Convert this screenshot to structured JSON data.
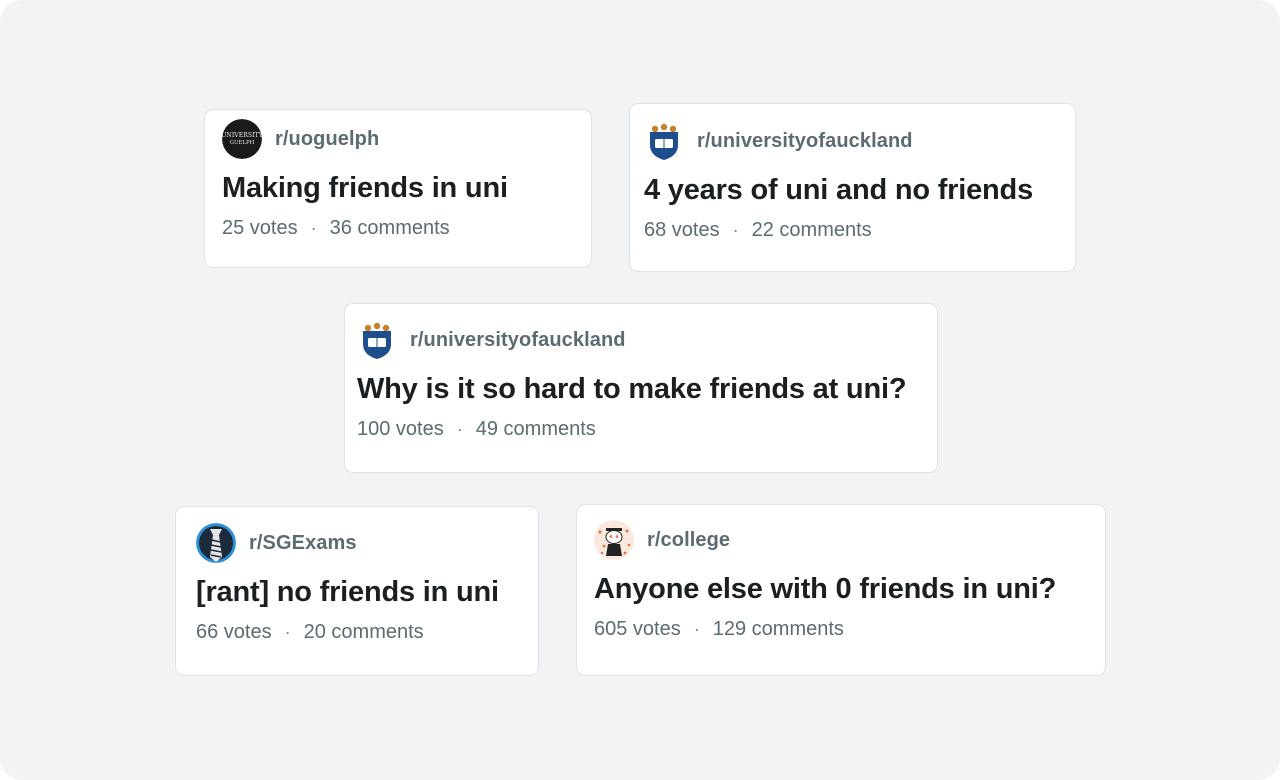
{
  "posts": [
    {
      "subreddit": "r/uoguelph",
      "avatar_icon": "university-of-guelph-logo-icon",
      "title": "Making friends in uni",
      "votes": "25 votes",
      "separator": "·",
      "comments": "36 comments"
    },
    {
      "subreddit": "r/universityofauckland",
      "avatar_icon": "university-of-auckland-crest-icon",
      "title": "4 years of uni and no friends",
      "votes": "68 votes",
      "separator": "·",
      "comments": "22 comments"
    },
    {
      "subreddit": "r/universityofauckland",
      "avatar_icon": "university-of-auckland-crest-icon",
      "title": "Why is it so hard to make friends at uni?",
      "votes": "100 votes",
      "separator": "·",
      "comments": "49 comments"
    },
    {
      "subreddit": "r/SGExams",
      "avatar_icon": "sgexams-tie-icon",
      "title": "[rant] no friends in uni",
      "votes": "66 votes",
      "separator": "·",
      "comments": "20 comments"
    },
    {
      "subreddit": "r/college",
      "avatar_icon": "college-mascot-icon",
      "title": "Anyone else with 0 friends in uni?",
      "votes": "605 votes",
      "separator": "·",
      "comments": "129 comments"
    }
  ],
  "colors": {
    "background": "#f2f3f5",
    "card": "#ffffff",
    "title": "#1c1f21",
    "muted": "#5c6b73",
    "auckland_blue": "#1f4e8c",
    "college_orange": "#e8743b"
  }
}
